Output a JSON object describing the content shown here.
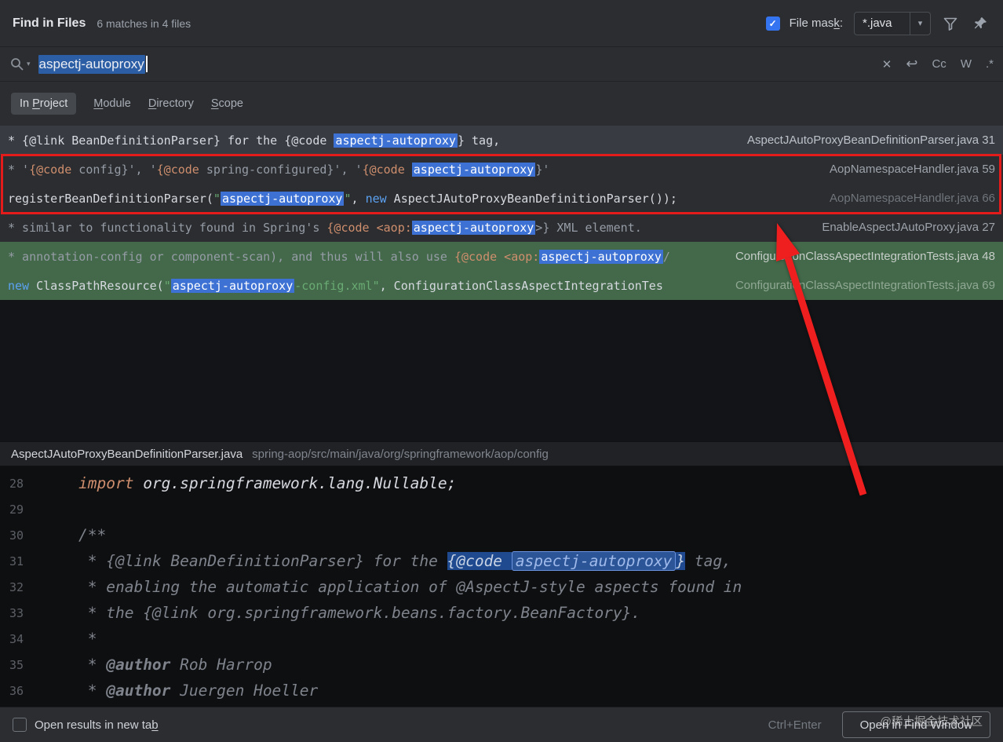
{
  "header": {
    "title": "Find in Files",
    "matches_summary": "6 matches in 4 files",
    "file_mask_label_segments": [
      {
        "t": "File mas",
        "c": "p"
      },
      {
        "t": "k",
        "c": "u"
      },
      {
        "t": ":",
        "c": "p"
      }
    ],
    "file_mask_value": "*.java",
    "file_mask_checked": true
  },
  "icons": {
    "checkmark": "✓",
    "dropdown_arrow": "▾",
    "search_dropdown_arrow": "▾",
    "clear": "✕",
    "history": "↩"
  },
  "search": {
    "query": "aspectj-autoproxy",
    "match_case_label": "Cc",
    "words_label": "W",
    "regex_label": ".*"
  },
  "scopes": {
    "items": [
      {
        "pre": "In ",
        "key": "P",
        "post": "roject",
        "selected": true
      },
      {
        "pre": "",
        "key": "M",
        "post": "odule",
        "selected": false
      },
      {
        "pre": "",
        "key": "D",
        "post": "irectory",
        "selected": false
      },
      {
        "pre": "",
        "key": "S",
        "post": "cope",
        "selected": false
      }
    ]
  },
  "results": {
    "rows": [
      {
        "selected": true,
        "segments": [
          {
            "t": "* {@link BeanDefinitionParser} for the {@code ",
            "c": "w"
          },
          {
            "t": "aspectj-autoproxy",
            "c": "m"
          },
          {
            "t": "} tag,",
            "c": "w"
          }
        ],
        "file": "AspectJAutoProxyBeanDefinitionParser.java",
        "line": "31"
      },
      {
        "segments": [
          {
            "t": "* '",
            "c": "g"
          },
          {
            "t": "{@code",
            "c": "o"
          },
          {
            "t": " config}', '",
            "c": "g"
          },
          {
            "t": "{@code",
            "c": "o"
          },
          {
            "t": " spring-configured}', '",
            "c": "g"
          },
          {
            "t": "{@code",
            "c": "o"
          },
          {
            "t": " ",
            "c": "g"
          },
          {
            "t": "aspectj-autoproxy",
            "c": "m"
          },
          {
            "t": "}'",
            "c": "g"
          }
        ],
        "file": "AopNamespaceHandler.java",
        "line": "59"
      },
      {
        "segments": [
          {
            "t": "registerBeanDefinitionParser(",
            "c": "w"
          },
          {
            "t": "\"",
            "c": "s"
          },
          {
            "t": "aspectj-autoproxy",
            "c": "m"
          },
          {
            "t": "\"",
            "c": "s"
          },
          {
            "t": ", ",
            "c": "w"
          },
          {
            "t": "new",
            "c": "k"
          },
          {
            "t": " AspectJAutoProxyBeanDefinitionParser());",
            "c": "w"
          }
        ],
        "file": "AopNamespaceHandler.java",
        "line": "66",
        "file_dim": true
      },
      {
        "segments": [
          {
            "t": "* similar to functionality found in Spring's ",
            "c": "g"
          },
          {
            "t": "{@code",
            "c": "o"
          },
          {
            "t": " ",
            "c": "g"
          },
          {
            "t": "<aop:",
            "c": "o"
          },
          {
            "t": "aspectj-autoproxy",
            "c": "m"
          },
          {
            "t": ">} XML element.",
            "c": "g"
          }
        ],
        "file": "EnableAspectJAutoProxy.java",
        "line": "27"
      },
      {
        "green": true,
        "segments": [
          {
            "t": "* annotation-config or component-scan), and thus will also use ",
            "c": "g"
          },
          {
            "t": "{@code",
            "c": "o"
          },
          {
            "t": " ",
            "c": "g"
          },
          {
            "t": "<aop:",
            "c": "o"
          },
          {
            "t": "aspectj-autoproxy",
            "c": "m"
          },
          {
            "t": "/",
            "c": "g"
          }
        ],
        "file": "ConfigurationClassAspectIntegrationTests.java",
        "line": "48"
      },
      {
        "green": true,
        "segments": [
          {
            "t": "new",
            "c": "k"
          },
          {
            "t": " ClassPathResource(",
            "c": "w"
          },
          {
            "t": "\"",
            "c": "s"
          },
          {
            "t": "aspectj-autoproxy",
            "c": "m"
          },
          {
            "t": "-config.xml\"",
            "c": "s"
          },
          {
            "t": ", ConfigurationClassAspectIntegrationTes",
            "c": "w"
          }
        ],
        "file": "ConfigurationClassAspectIntegrationTests.java",
        "line": "69",
        "file_dim": true
      }
    ]
  },
  "preview": {
    "file": "AspectJAutoProxyBeanDefinitionParser.java",
    "path": "spring-aop/src/main/java/org/springframework/aop/config",
    "lines": [
      {
        "no": "28",
        "segments": [
          {
            "t": "import",
            "c": "o"
          },
          {
            "t": " org.springframework.lang.Nullable;",
            "c": "w"
          }
        ]
      },
      {
        "no": "29",
        "segments": []
      },
      {
        "no": "30",
        "segments": [
          {
            "t": "/**",
            "c": "c"
          }
        ]
      },
      {
        "no": "31",
        "segments": [
          {
            "t": " * {@link BeanDefinitionParser} for the ",
            "c": "c"
          },
          {
            "t": "{@code ",
            "c": "sel"
          },
          {
            "t": "aspectj-autoproxy",
            "c": "mbox"
          },
          {
            "t": "}",
            "c": "sel"
          },
          {
            "t": " tag,",
            "c": "c"
          }
        ]
      },
      {
        "no": "32",
        "segments": [
          {
            "t": " * enabling the automatic application of @AspectJ-style aspects found in",
            "c": "c"
          }
        ]
      },
      {
        "no": "33",
        "segments": [
          {
            "t": " * the {@link org.springframework.beans.factory.BeanFactory}.",
            "c": "c"
          }
        ]
      },
      {
        "no": "34",
        "segments": [
          {
            "t": " *",
            "c": "c"
          }
        ]
      },
      {
        "no": "35",
        "segments": [
          {
            "t": " * ",
            "c": "c"
          },
          {
            "t": "@author",
            "c": "tag"
          },
          {
            "t": " Rob Harrop",
            "c": "c"
          }
        ]
      },
      {
        "no": "36",
        "segments": [
          {
            "t": " * ",
            "c": "c"
          },
          {
            "t": "@author",
            "c": "tag"
          },
          {
            "t": " Juergen Hoeller",
            "c": "c"
          }
        ]
      }
    ]
  },
  "footer": {
    "checkbox_label_segments": [
      {
        "t": "Open results in new ta",
        "c": "p"
      },
      {
        "t": "b",
        "c": "u"
      }
    ],
    "shortcut": "Ctrl+Enter",
    "button_label": "Open in Find Window",
    "watermark": "@稀土掘金技术社区"
  },
  "colors": {
    "accent": "#3574f0",
    "match_highlight": "#3d72d4",
    "green_row": "#43694a",
    "annotation_red": "#e31b1b"
  }
}
